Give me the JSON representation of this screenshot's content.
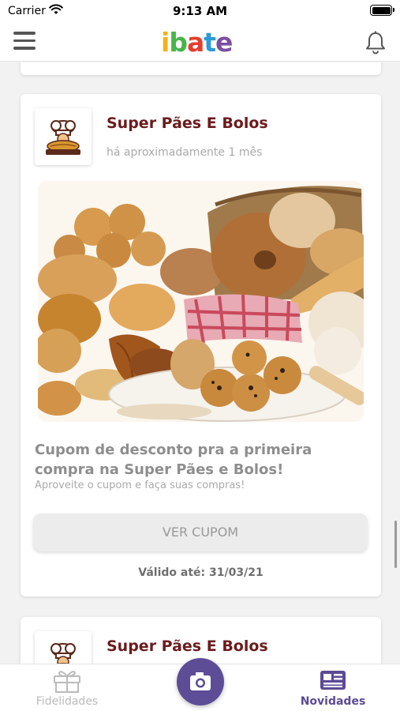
{
  "status_bar": {
    "carrier": "Carrier",
    "time": "9:13 AM"
  },
  "header": {
    "logo_text": "ibate",
    "icons": [
      "menu-icon",
      "bell-icon"
    ]
  },
  "feed": [
    {
      "store_name": "Super Pães E Bolos",
      "posted": "há aproximadamente 1 mês",
      "title": "Cupom de desconto pra a primeira compra na Super Pães e Bolos!",
      "subtitle": "Aproveite o cupom e faça suas compras!",
      "button_label": "VER CUPOM",
      "valid_until": "Válido até: 31/03/21"
    },
    {
      "store_name": "Super Pães E Bolos"
    }
  ],
  "tab_bar": {
    "tabs": [
      {
        "label": "Fidelidades",
        "icon": "gift-icon",
        "active": false
      },
      {
        "label": "Novidades",
        "icon": "news-icon",
        "active": true
      }
    ],
    "center_icon": "camera-icon"
  },
  "colors": {
    "accent": "#5d4d97",
    "store_name": "#6c1b1b",
    "tab_active": "#5c4a96",
    "tab_inactive": "#bbbbbb"
  }
}
